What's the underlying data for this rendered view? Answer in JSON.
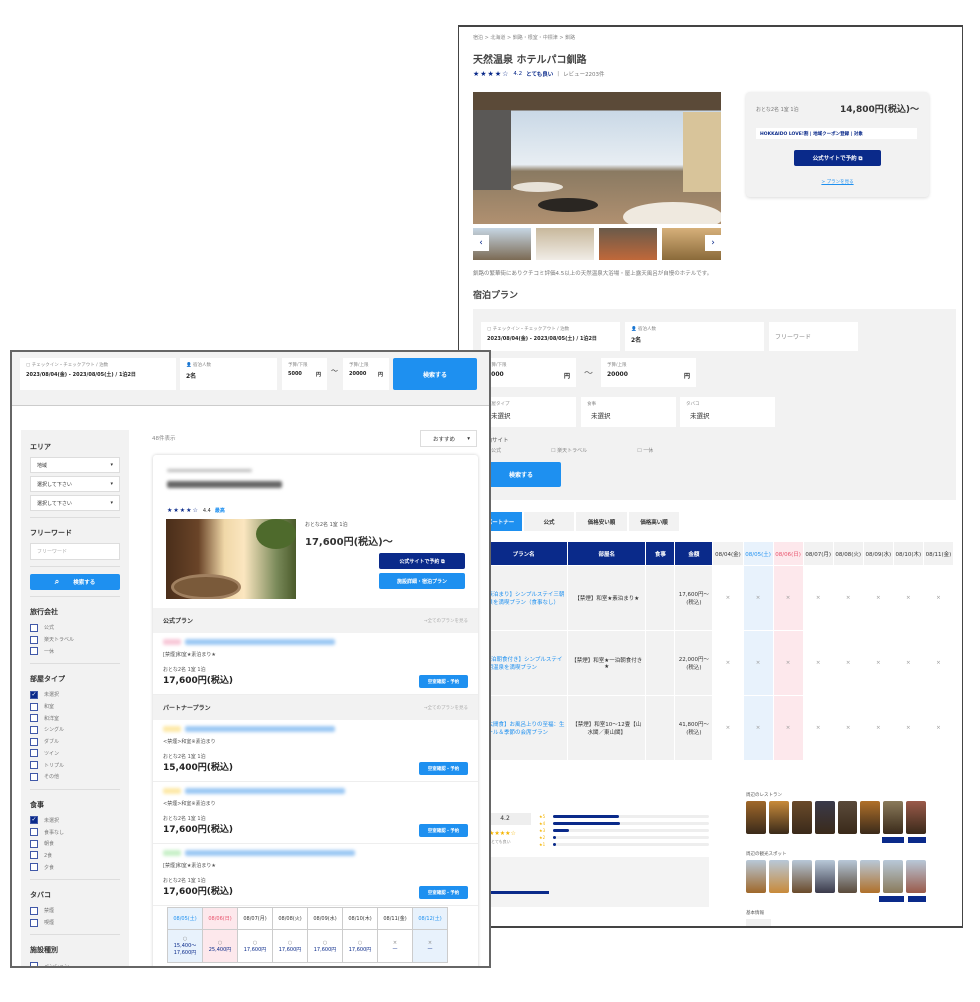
{
  "colors": {
    "navy": "#0a2a8a",
    "blue": "#1e90f0",
    "saturday": "#e8f2fc",
    "sunday": "#fde8ec"
  },
  "detail": {
    "breadcrumb": [
      "宿泊",
      "北海道",
      "釧路・根室・中標津",
      "釧路"
    ],
    "title": "天然温泉 ホテルパコ釧路",
    "rating": {
      "stars": 4.2,
      "score": "4.2",
      "label": "とても良い",
      "reviews": "レビュー2203件"
    },
    "price_card": {
      "guests": "おとな2名 1室 1泊",
      "price": "14,800円(税込)〜",
      "campaign": "HOKKAIDO LOVE!割 | 地域クーポン登録 | 対象",
      "book_button": "公式サイトで予約 ⧉",
      "plans_link": "> プランを見る"
    },
    "description": "釧路の繁華街にありクチコミ評価4.5以上の天然温泉大浴場・屋上露天風呂が自慢のホテルです。",
    "plans_heading": "宿泊プラン",
    "search": {
      "checkin_label": "チェックイン・チェックアウト / 泊数",
      "checkin_value": "2023/08/04(金) - 2023/08/05(土) / 1泊2日",
      "people_label": "宿泊人数",
      "people_value": "2名",
      "freeword_placeholder": "フリーワード",
      "budget_min_label": "予算/下限",
      "budget_min": "5000",
      "budget_max_label": "予算/上限",
      "budget_max": "20000",
      "yen": "円",
      "tilde": "〜",
      "room_type_label": "部屋タイプ",
      "room_type": "未選択",
      "meal_label": "食事",
      "meal": "未選択",
      "tobacco_label": "タバコ",
      "tobacco": "未選択",
      "site_label": "予約サイト",
      "sites": [
        "公式",
        "楽天トラベル",
        "一休"
      ],
      "button": "検索する"
    },
    "tabs": [
      "パートナー",
      "公式",
      "価格安い順",
      "価格高い順"
    ],
    "table": {
      "headers": [
        "プラン名",
        "部屋名",
        "食事",
        "金額"
      ],
      "dates": [
        "08/04(金)",
        "08/05(土)",
        "08/06(日)",
        "08/07(月)",
        "08/08(火)",
        "08/09(水)",
        "08/10(木)",
        "08/11(金)"
      ],
      "rows": [
        {
          "plan": "【素泊まり】シンプルステイ三朝温泉を満喫プラン（食事なし）",
          "room": "【禁煙】和室★素泊まり★",
          "meal": "",
          "price": "17,600円〜(税込)",
          "avail": "×"
        },
        {
          "plan": "【1泊朝食付き】シンプルステイ三朝温泉を満喫プラン",
          "room": "【禁煙】和室★一泊朝食付き★",
          "meal": "",
          "price": "22,000円〜(税込)",
          "avail": "×"
        },
        {
          "plan": "【広間食】お風呂上りの至福：生ビール＆季節の会席プラン",
          "room": "【禁煙】和室10〜12畳【山水閣／東山閣】",
          "meal": "",
          "price": "41,800円〜(税込)",
          "avail": "×"
        }
      ]
    },
    "reviews": {
      "score": "4.2",
      "label": "とても良い",
      "distribution": [
        {
          "stars": "★5",
          "fraction": 0.42
        },
        {
          "stars": "★4",
          "fraction": 0.43
        },
        {
          "stars": "★3",
          "fraction": 0.1
        },
        {
          "stars": "★2",
          "fraction": 0.02
        },
        {
          "stars": "★1",
          "fraction": 0.02
        }
      ]
    },
    "nearby": {
      "restaurants": "周辺のレストラン",
      "spots": "周辺の観光スポット",
      "basic_info": "基本情報"
    }
  },
  "list": {
    "search": {
      "checkin_label": "チェックイン・チェックアウト / 泊数",
      "checkin_value": "2023/08/04(金) - 2023/08/05(土) / 1泊2日",
      "people_label": "宿泊人数",
      "people_value": "2名",
      "budget_min_label": "予算/下限",
      "budget_min": "5000",
      "budget_max_label": "予算/上限",
      "budget_max": "20000",
      "yen": "円",
      "tilde": "〜",
      "button": "検索する"
    },
    "count": "48件表示",
    "sort": "おすすめ",
    "sidebar": {
      "area_title": "エリア",
      "area_selects": [
        "地域",
        "選択して下さい",
        "選択して下さい"
      ],
      "freeword_title": "フリーワード",
      "freeword_placeholder": "フリーワード",
      "search_button": "検索する",
      "groups": [
        {
          "title": "旅行会社",
          "items": [
            {
              "label": "公式",
              "checked": false
            },
            {
              "label": "楽天トラベル",
              "checked": false
            },
            {
              "label": "一休",
              "checked": false
            }
          ]
        },
        {
          "title": "部屋タイプ",
          "items": [
            {
              "label": "未選択",
              "checked": true
            },
            {
              "label": "和室",
              "checked": false
            },
            {
              "label": "和洋室",
              "checked": false
            },
            {
              "label": "シングル",
              "checked": false
            },
            {
              "label": "ダブル",
              "checked": false
            },
            {
              "label": "ツイン",
              "checked": false
            },
            {
              "label": "トリプル",
              "checked": false
            },
            {
              "label": "その他",
              "checked": false
            }
          ]
        },
        {
          "title": "食事",
          "items": [
            {
              "label": "未選択",
              "checked": true
            },
            {
              "label": "食事なし",
              "checked": false
            },
            {
              "label": "朝食",
              "checked": false
            },
            {
              "label": "2食",
              "checked": false
            },
            {
              "label": "夕食",
              "checked": false
            }
          ]
        },
        {
          "title": "タバコ",
          "items": [
            {
              "label": "禁煙",
              "checked": false
            },
            {
              "label": "喫煙",
              "checked": false
            }
          ]
        },
        {
          "title": "施設種別",
          "items": [
            {
              "label": "ペンション",
              "checked": false
            },
            {
              "label": "ホテル",
              "checked": false
            },
            {
              "label": "旅館",
              "checked": false
            },
            {
              "label": "ビジネスホテル",
              "checked": false
            },
            {
              "label": "簡易宿泊所",
              "checked": false
            }
          ]
        }
      ]
    },
    "card": {
      "rating": "4.4",
      "rating_label": "最高",
      "guests": "おとな2名 1室 1泊",
      "price": "17,600円(税込)〜",
      "book_button": "公式サイトで予約 ⧉",
      "detail_button": "施設詳細・宿泊プラン",
      "official_heading": "公式プラン",
      "partner_heading": "パートナープラン",
      "see_all": "→全てのプランを見る",
      "official_plans": [
        {
          "room": "[禁煙]和室★素泊まり★",
          "guests": "おとな2名 1室 1泊",
          "price": "17,600円(税込)",
          "button": "空室確認・予約",
          "tag": "#f8c8d8"
        }
      ],
      "partner_plans": [
        {
          "room": "<禁煙>和室※素泊まり",
          "guests": "おとな2名 1室 1泊",
          "price": "15,400円(税込)",
          "button": "空室確認・予約",
          "tag": "#fde9a8"
        },
        {
          "room": "<禁煙>和室※素泊まり",
          "guests": "おとな2名 1室 1泊",
          "price": "17,600円(税込)",
          "button": "空室確認・予約",
          "tag": "#fde9a8"
        },
        {
          "room": "[禁煙]和室★素泊まり★",
          "guests": "おとな2名 1室 1泊",
          "price": "17,600円(税込)",
          "button": "空室確認・予約",
          "tag": "#c8f0c8"
        }
      ],
      "calendar": [
        {
          "date": "08/05(土)",
          "mark": "○",
          "price": "15,400〜17,600円",
          "kind": "sat"
        },
        {
          "date": "08/06(日)",
          "mark": "○",
          "price": "25,400円",
          "kind": "sun"
        },
        {
          "date": "08/07(月)",
          "mark": "○",
          "price": "17,600円",
          "kind": ""
        },
        {
          "date": "08/08(火)",
          "mark": "○",
          "price": "17,600円",
          "kind": ""
        },
        {
          "date": "08/09(水)",
          "mark": "○",
          "price": "17,600円",
          "kind": ""
        },
        {
          "date": "08/10(木)",
          "mark": "○",
          "price": "17,600円",
          "kind": ""
        },
        {
          "date": "08/11(金)",
          "mark": "×",
          "price": "—",
          "kind": ""
        },
        {
          "date": "08/12(土)",
          "mark": "×",
          "price": "—",
          "kind": "sat"
        }
      ]
    }
  }
}
